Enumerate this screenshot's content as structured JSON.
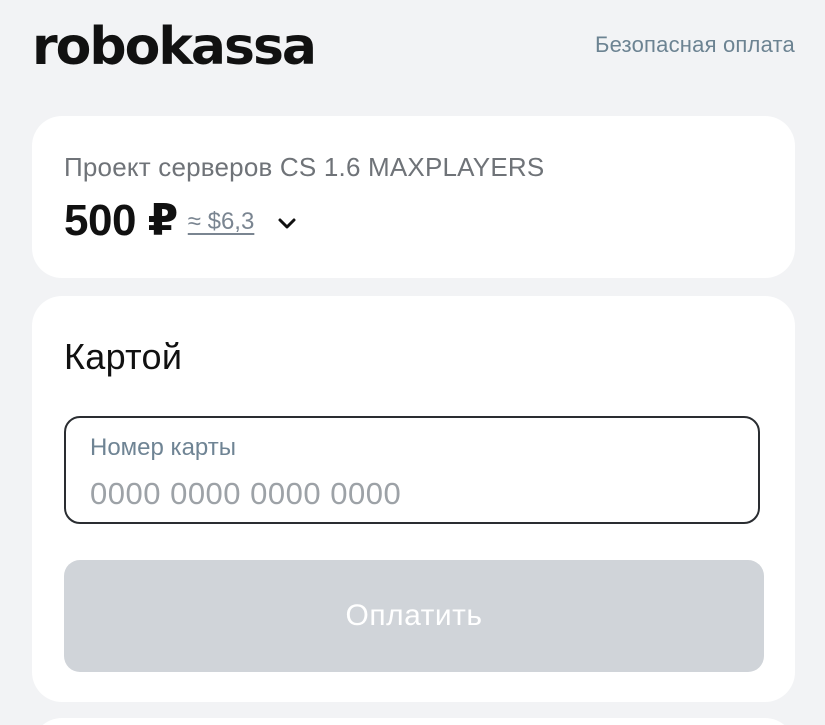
{
  "header": {
    "logo": "robokassa",
    "secure_label": "Безопасная оплата"
  },
  "order": {
    "title": "Проект серверов CS 1.6 MAXPLAYERS",
    "amount": "500 ₽",
    "approx": "≈ $6,3",
    "expand_icon": "chevron-down-icon"
  },
  "payment": {
    "method_title": "Картой",
    "card_field": {
      "label": "Номер карты",
      "value": "",
      "placeholder": "0000 0000 0000 0000"
    },
    "pay_button_label": "Оплатить"
  },
  "colors": {
    "background": "#f2f3f5",
    "card": "#ffffff",
    "link": "#6c8392",
    "button_disabled": "#d0d4d9"
  }
}
